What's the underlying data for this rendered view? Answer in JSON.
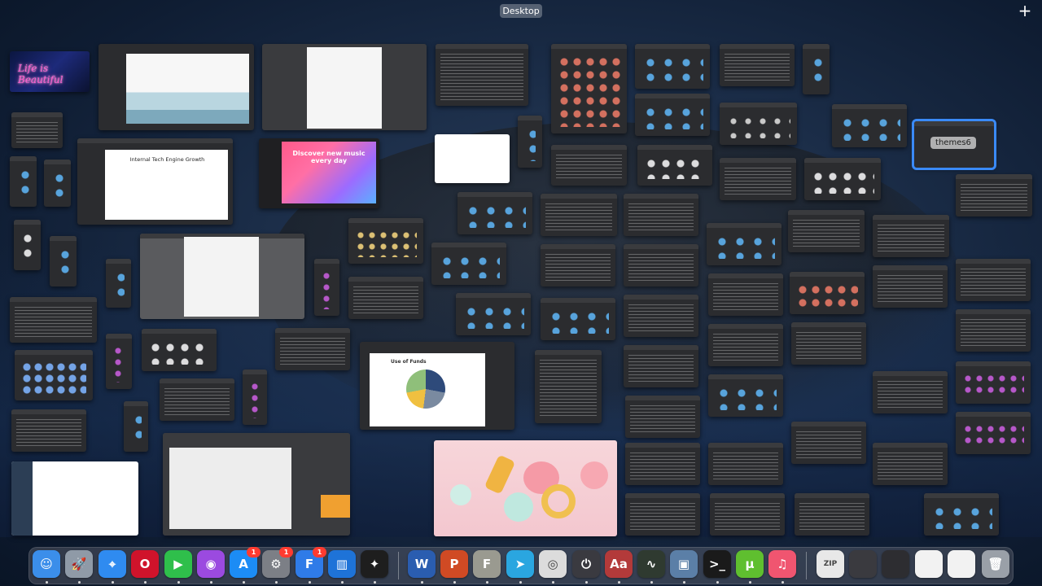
{
  "mission_control": {
    "space_label": "Desktop",
    "add_space_symbol": "+",
    "selected_window_title": "themes6"
  },
  "windows_text": {
    "presentation_title": "Internal Tech Engine Growth",
    "music_banner": "Discover new music every day",
    "funds_title": "Use of Funds",
    "neon_sign": "Life is Beautiful"
  },
  "dock": {
    "apps": [
      {
        "name": "Finder",
        "glyph": "☺",
        "color": "#3b8eea"
      },
      {
        "name": "Launchpad",
        "glyph": "🚀",
        "color": "#8f9aa7"
      },
      {
        "name": "Safari",
        "glyph": "⌖",
        "color": "#2f8bf0"
      },
      {
        "name": "Opera",
        "glyph": "O",
        "color": "#d0132b"
      },
      {
        "name": "FaceTime",
        "glyph": "▶",
        "color": "#2fbf4b"
      },
      {
        "name": "Podcasts",
        "glyph": "◉",
        "color": "#9b4ae0"
      },
      {
        "name": "App Store",
        "glyph": "A",
        "color": "#1c8cf5",
        "badge": "1"
      },
      {
        "name": "System Preferences",
        "glyph": "⚙",
        "color": "#7c7f86",
        "badge": "1"
      },
      {
        "name": "Fantastical",
        "glyph": "F",
        "color": "#2f7be8",
        "badge": "1"
      },
      {
        "name": "Trello",
        "glyph": "▥",
        "color": "#1e73d8"
      },
      {
        "name": "Figma",
        "glyph": "✦",
        "color": "#1e1e1e"
      },
      {
        "name": "Word",
        "glyph": "W",
        "color": "#2a5db0"
      },
      {
        "name": "PowerPoint",
        "glyph": "P",
        "color": "#d04a24"
      },
      {
        "name": "Font Book",
        "glyph": "F",
        "color": "#9a9a90"
      },
      {
        "name": "Telegram",
        "glyph": "➤",
        "color": "#2aa6e0"
      },
      {
        "name": "Chrome",
        "glyph": "◎",
        "color": "#dcdcdc"
      },
      {
        "name": "Shutdown",
        "glyph": "⏻",
        "color": "#3a3a40"
      },
      {
        "name": "Dictionary",
        "glyph": "Aa",
        "color": "#b33a3a"
      },
      {
        "name": "Activity Monitor",
        "glyph": "∿",
        "color": "#2f3a30"
      },
      {
        "name": "Preview",
        "glyph": "▣",
        "color": "#5b7fa7"
      },
      {
        "name": "Terminal",
        "glyph": ">_",
        "color": "#1a1a1a"
      },
      {
        "name": "uTorrent",
        "glyph": "µ",
        "color": "#5fbf2f"
      },
      {
        "name": "Music",
        "glyph": "♫",
        "color": "#f05570"
      },
      {
        "name": "Archive",
        "glyph": "ZIP",
        "color": "#e8e8e8"
      },
      {
        "name": "Window Thumb 1",
        "glyph": "",
        "color": "#3a3a3f"
      },
      {
        "name": "Window Thumb 2",
        "glyph": "",
        "color": "#2d2d31"
      },
      {
        "name": "Window Thumb 3",
        "glyph": "",
        "color": "#f2f2f2"
      },
      {
        "name": "Window Thumb 4",
        "glyph": "",
        "color": "#f2f2f2"
      },
      {
        "name": "Trash",
        "glyph": "🗑",
        "color": "#9aa0a8"
      }
    ]
  }
}
